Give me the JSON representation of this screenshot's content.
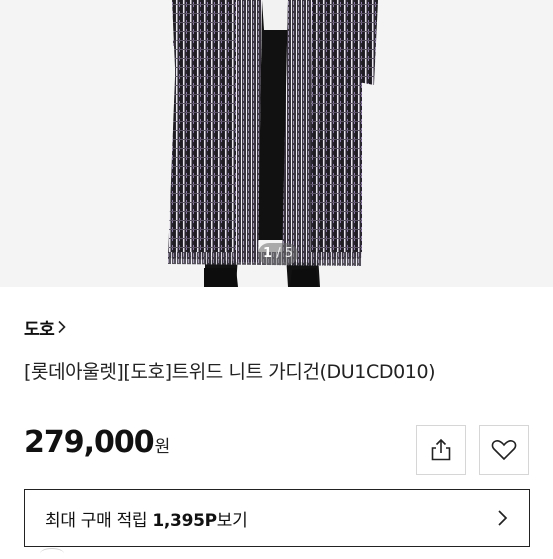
{
  "gallery": {
    "current": "1",
    "separator": "/",
    "total": "5"
  },
  "brand": {
    "name": "도호"
  },
  "product": {
    "title": "[롯데아울렛][도호]트위드 니트 가디건(DU1CD010)",
    "price": "279,000",
    "currency": "원"
  },
  "points": {
    "prefix": "최대 구매 적립 ",
    "amount": "1,395P",
    "suffix": "보기"
  },
  "icons": {
    "share": "share-icon",
    "wishlist": "heart-icon",
    "brand_arrow": "chevron-right-icon",
    "points_arrow": "chevron-right-icon"
  },
  "colors": {
    "background": "#ffffff",
    "border": "#d6d6d6",
    "text": "#111111"
  }
}
